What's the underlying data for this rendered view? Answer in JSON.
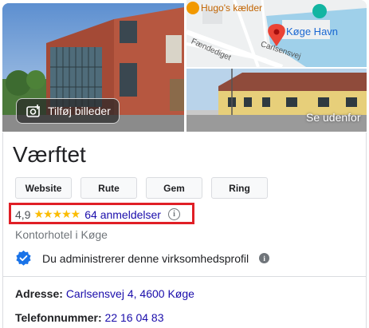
{
  "photos": {
    "add_photo_label": "Tilføj billeder",
    "see_outside_label": "Se udenfor",
    "map_labels": {
      "restaurant": "Hugo's kælder",
      "harbor": "Køge Havn",
      "street1": "Fændediget",
      "street2": "Carlsensvej"
    }
  },
  "business": {
    "name": "Værftet",
    "actions": [
      "Website",
      "Rute",
      "Gem",
      "Ring"
    ],
    "rating": "4,9",
    "stars": "★★★★★",
    "reviews": "64 anmeldelser",
    "category": "Kontorhotel i Køge",
    "verified_text": "Du administrerer denne virksomhedsprofil",
    "address_label": "Adresse:",
    "address_value": "Carlsensvej 4, 4600 Køge",
    "phone_label": "Telefonnummer:",
    "phone_value": "22 16 04 83"
  },
  "colors": {
    "link": "#1a0dab",
    "star": "#fbbc04",
    "highlight_border": "#e01f26",
    "verified_badge": "#1a73e8"
  }
}
